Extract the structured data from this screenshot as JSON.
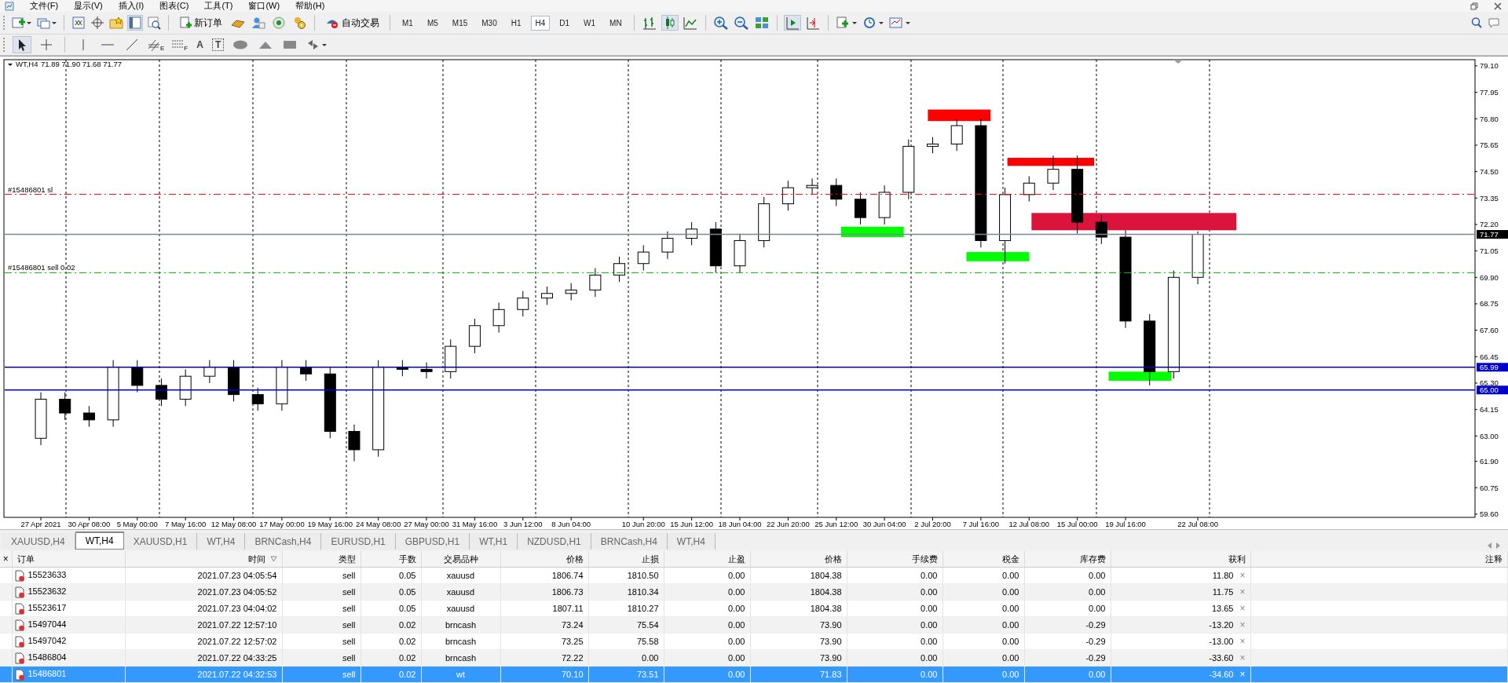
{
  "menu": [
    {
      "label": "文件(F)"
    },
    {
      "label": "显示(V)"
    },
    {
      "label": "插入(I)"
    },
    {
      "label": "图表(C)"
    },
    {
      "label": "工具(T)"
    },
    {
      "label": "窗口(W)"
    },
    {
      "label": "帮助(H)"
    }
  ],
  "toolbar": {
    "new_order": "新订单",
    "auto_trading": "自动交易",
    "timeframes": [
      {
        "label": "M1",
        "selected": false
      },
      {
        "label": "M5",
        "selected": false
      },
      {
        "label": "M15",
        "selected": false
      },
      {
        "label": "M30",
        "selected": false
      },
      {
        "label": "H1",
        "selected": false
      },
      {
        "label": "H4",
        "selected": true
      },
      {
        "label": "D1",
        "selected": false
      },
      {
        "label": "W1",
        "selected": false
      },
      {
        "label": "MN",
        "selected": false
      }
    ]
  },
  "drawing_tools": {
    "channel_mark": "E",
    "fibo_mark": "F",
    "text_tool": "A",
    "label_tool": "T"
  },
  "chart": {
    "symbol": "WT,H4",
    "ohlc": "71.89 71.90 71.68 71.77",
    "chart_data": {
      "type": "candlestick",
      "grid": true,
      "ylim": [
        59.46,
        79.37
      ],
      "categories": [
        null,
        "27 Apr 2021",
        null,
        "30 Apr 08:00",
        null,
        "5 May 00:00",
        null,
        "7 May 16:00",
        null,
        "12 May 08:00",
        null,
        "17 May 00:00",
        null,
        "19 May 16:00",
        null,
        "24 May 08:00",
        null,
        "27 May 00:00",
        null,
        "31 May 16:00",
        null,
        "3 Jun 12:00",
        null,
        "8 Jun 04:00",
        null,
        null,
        "10 Jun 20:00",
        null,
        "15 Jun 12:00",
        null,
        "18 Jun 04:00",
        null,
        "22 Jun 20:00",
        null,
        "25 Jun 12:00",
        null,
        "30 Jun 04:00",
        null,
        "2 Jul 20:00",
        null,
        "7 Jul 16:00",
        null,
        "12 Jul 08:00",
        null,
        "15 Jul 00:00",
        null,
        "19 Jul 16:00",
        null,
        null,
        "22 Jul 08:00",
        null,
        null,
        null,
        null,
        null,
        null,
        null,
        null,
        null,
        null,
        null
      ],
      "ohlc": [
        null,
        [
          62.9,
          64.9,
          62.6,
          64.6
        ],
        [
          64.6,
          64.9,
          63.7,
          64.0
        ],
        [
          64.0,
          64.3,
          63.4,
          63.7
        ],
        [
          63.7,
          66.3,
          63.4,
          66.0
        ],
        [
          66.0,
          66.3,
          64.9,
          65.2
        ],
        [
          65.2,
          65.5,
          64.3,
          64.6
        ],
        [
          64.6,
          65.9,
          64.3,
          65.6
        ],
        [
          65.6,
          66.3,
          65.3,
          66.0
        ],
        [
          66.0,
          66.3,
          64.5,
          64.8
        ],
        [
          64.8,
          65.1,
          64.1,
          64.4
        ],
        [
          64.4,
          66.3,
          64.1,
          66.0
        ],
        [
          66.0,
          66.3,
          65.4,
          65.7
        ],
        [
          65.7,
          66.0,
          62.9,
          63.2
        ],
        [
          63.2,
          63.5,
          61.9,
          62.4
        ],
        [
          62.4,
          66.3,
          62.1,
          66.0
        ],
        [
          66.0,
          66.3,
          65.6,
          65.9
        ],
        [
          65.9,
          66.2,
          65.5,
          65.8
        ],
        [
          65.8,
          67.2,
          65.5,
          66.9
        ],
        [
          66.9,
          68.1,
          66.6,
          67.8
        ],
        [
          67.8,
          68.8,
          67.5,
          68.5
        ],
        [
          68.5,
          69.3,
          68.2,
          69.0
        ],
        [
          69.0,
          69.5,
          68.7,
          69.2
        ],
        [
          69.2,
          69.65,
          68.9,
          69.35
        ],
        [
          69.35,
          70.3,
          69.05,
          70.0
        ],
        [
          70.0,
          70.8,
          69.7,
          70.5
        ],
        [
          70.5,
          71.3,
          70.2,
          71.0
        ],
        [
          71.0,
          71.9,
          70.7,
          71.6
        ],
        [
          71.6,
          72.3,
          71.3,
          72.0
        ],
        [
          72.0,
          72.3,
          70.1,
          70.4
        ],
        [
          70.4,
          71.8,
          70.1,
          71.5
        ],
        [
          71.5,
          73.4,
          71.2,
          73.1
        ],
        [
          73.1,
          74.1,
          72.8,
          73.8
        ],
        [
          73.8,
          74.2,
          73.5,
          73.9
        ],
        [
          73.9,
          74.2,
          73.0,
          73.3
        ],
        [
          73.3,
          73.6,
          72.2,
          72.5
        ],
        [
          72.5,
          73.9,
          72.2,
          73.6
        ],
        [
          73.6,
          75.9,
          73.3,
          75.6
        ],
        [
          75.6,
          76.0,
          75.3,
          75.7
        ],
        [
          75.7,
          76.8,
          75.4,
          76.5
        ],
        [
          76.5,
          76.8,
          71.2,
          71.5
        ],
        [
          71.5,
          73.8,
          70.5,
          73.5
        ],
        [
          73.5,
          74.3,
          73.2,
          74.0
        ],
        [
          74.0,
          75.2,
          73.7,
          74.6
        ],
        [
          74.6,
          75.2,
          71.8,
          72.3
        ],
        [
          72.3,
          72.6,
          71.35,
          71.65
        ],
        [
          71.65,
          71.95,
          67.7,
          68.0
        ],
        [
          68.0,
          68.3,
          65.2,
          65.8
        ],
        [
          65.8,
          70.2,
          65.5,
          69.9
        ],
        [
          69.9,
          71.9,
          69.6,
          71.77
        ],
        null,
        null,
        null,
        null,
        null,
        null,
        null,
        null,
        null,
        null,
        null
      ],
      "yticks": [
        {
          "value": 79.1,
          "label": "79.10"
        },
        {
          "value": 77.95,
          "label": "77.95"
        },
        {
          "value": 76.8,
          "label": "76.80"
        },
        {
          "value": 75.65,
          "label": "75.65"
        },
        {
          "value": 74.5,
          "label": "74.50"
        },
        {
          "value": 73.35,
          "label": "73.35"
        },
        {
          "value": 72.2,
          "label": "72.20"
        },
        {
          "value": 71.05,
          "label": "71.05"
        },
        {
          "value": 69.9,
          "label": "69.90"
        },
        {
          "value": 68.75,
          "label": "68.75"
        },
        {
          "value": 67.6,
          "label": "67.60"
        },
        {
          "value": 66.45,
          "label": "66.45"
        },
        {
          "value": 65.3,
          "label": "65.30"
        },
        {
          "value": 64.15,
          "label": "64.15"
        },
        {
          "value": 63.0,
          "label": "63.00"
        },
        {
          "value": 61.9,
          "label": "61.90"
        },
        {
          "value": 60.75,
          "label": "60.75"
        },
        {
          "value": 59.6,
          "label": "59.60"
        }
      ],
      "annotations": [
        "#15486801 sl",
        "#15486801 sell 0.02"
      ],
      "ref_lines": [
        {
          "axis": "y",
          "value": 73.51,
          "color": "#ff0000"
        },
        {
          "axis": "y",
          "value": 71.77,
          "color": "#778899",
          "label": "71.77"
        },
        {
          "axis": "y",
          "value": 70.1,
          "color": "#00c000"
        },
        {
          "axis": "y",
          "value": 65.99,
          "color": "#0000cc",
          "label": "65.99"
        },
        {
          "axis": "y",
          "value": 65.0,
          "color": "#0000cc",
          "label": "65.00"
        }
      ]
    }
  },
  "chart_tabs": [
    {
      "label": "XAUUSD,H4",
      "selected": false
    },
    {
      "label": "WT,H4",
      "selected": true
    },
    {
      "label": "XAUUSD,H1",
      "selected": false
    },
    {
      "label": "WT,H4",
      "selected": false
    },
    {
      "label": "BRNCash,H4",
      "selected": false
    },
    {
      "label": "EURUSD,H1",
      "selected": false
    },
    {
      "label": "GBPUSD,H1",
      "selected": false
    },
    {
      "label": "WT,H1",
      "selected": false
    },
    {
      "label": "NZDUSD,H1",
      "selected": false
    },
    {
      "label": "BRNCash,H4",
      "selected": false
    },
    {
      "label": "WT,H4",
      "selected": false
    }
  ],
  "orders": {
    "close_glyph": "×",
    "columns": [
      "订单",
      "时间",
      "类型",
      "手数",
      "交易品种",
      "价格",
      "止损",
      "止盈",
      "价格",
      "手续费",
      "税金",
      "库存费",
      "获利",
      "注释"
    ],
    "rows": [
      {
        "cells": [
          "15523633",
          "2021.07.23 04:05:54",
          "sell",
          "0.05",
          "xauusd",
          "1806.74",
          "1810.50",
          "0.00",
          "1804.38",
          "0.00",
          "0.00",
          "0.00",
          "11.80"
        ],
        "close_mark": "×",
        "selected": false
      },
      {
        "cells": [
          "15523632",
          "2021.07.23 04:05:52",
          "sell",
          "0.05",
          "xauusd",
          "1806.73",
          "1810.34",
          "0.00",
          "1804.38",
          "0.00",
          "0.00",
          "0.00",
          "11.75"
        ],
        "close_mark": "×",
        "selected": false
      },
      {
        "cells": [
          "15523617",
          "2021.07.23 04:04:02",
          "sell",
          "0.05",
          "xauusd",
          "1807.11",
          "1810.27",
          "0.00",
          "1804.38",
          "0.00",
          "0.00",
          "0.00",
          "13.65"
        ],
        "close_mark": "×",
        "selected": false
      },
      {
        "cells": [
          "15497044",
          "2021.07.22 12:57:10",
          "sell",
          "0.02",
          "brncash",
          "73.24",
          "75.54",
          "0.00",
          "73.90",
          "0.00",
          "0.00",
          "-0.29",
          "-13.20"
        ],
        "close_mark": "×",
        "selected": false
      },
      {
        "cells": [
          "15497042",
          "2021.07.22 12:57:02",
          "sell",
          "0.02",
          "brncash",
          "73.25",
          "75.58",
          "0.00",
          "73.90",
          "0.00",
          "0.00",
          "-0.29",
          "-13.00"
        ],
        "close_mark": "×",
        "selected": false
      },
      {
        "cells": [
          "15486804",
          "2021.07.22 04:33:25",
          "sell",
          "0.02",
          "brncash",
          "72.22",
          "0.00",
          "0.00",
          "73.90",
          "0.00",
          "0.00",
          "-0.29",
          "-33.60"
        ],
        "close_mark": "×",
        "selected": false
      },
      {
        "cells": [
          "15486801",
          "2021.07.22 04:32:53",
          "sell",
          "0.02",
          "wt",
          "70.10",
          "73.51",
          "0.00",
          "71.83",
          "0.00",
          "0.00",
          "0.00",
          "-34.60"
        ],
        "close_mark": "×",
        "selected": true
      }
    ]
  }
}
